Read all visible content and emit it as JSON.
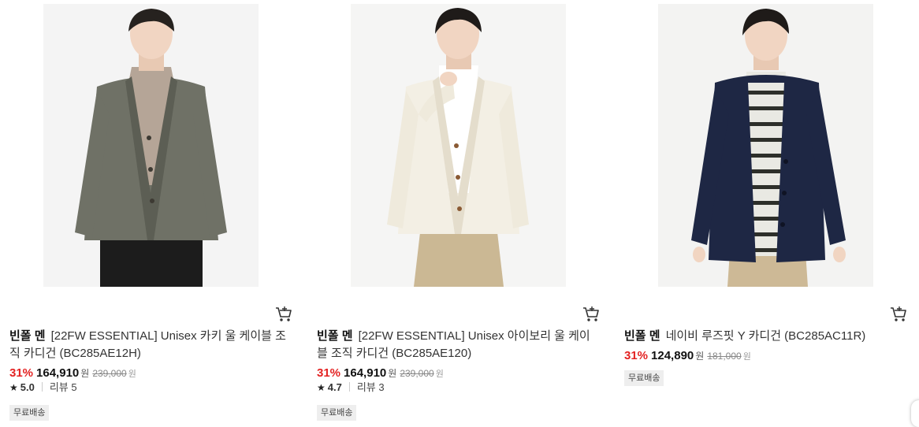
{
  "products": [
    {
      "brand": "빈폴 멘",
      "name": "[22FW ESSENTIAL] Unisex 카키 울 케이블 조직 카디건 (BC285AE12H)",
      "discount": "31%",
      "price": "164,910",
      "price_unit": "원",
      "original_price": "239,000",
      "original_unit": "원",
      "rating": "5.0",
      "review_label": "리뷰 5",
      "badge": "무료배송",
      "cardigan_color": "#6f7166",
      "inner_color": "#b5a597"
    },
    {
      "brand": "빈폴 멘",
      "name": "[22FW ESSENTIAL] Unisex 아이보리 울 케이블 조직 카디건 (BC285AE120)",
      "discount": "31%",
      "price": "164,910",
      "price_unit": "원",
      "original_price": "239,000",
      "original_unit": "원",
      "rating": "4.7",
      "review_label": "리뷰 3",
      "badge": "무료배송",
      "cardigan_color": "#f3efe4",
      "inner_color": "#ffffff"
    },
    {
      "brand": "빈폴 멘",
      "name": "네이비 루즈핏 Y 카디건 (BC285AC11R)",
      "discount": "31%",
      "price": "124,890",
      "price_unit": "원",
      "original_price": "181,000",
      "original_unit": "원",
      "badge": "무료배송",
      "cardigan_color": "#1e2744",
      "inner_color": "#e9e9e3"
    }
  ]
}
